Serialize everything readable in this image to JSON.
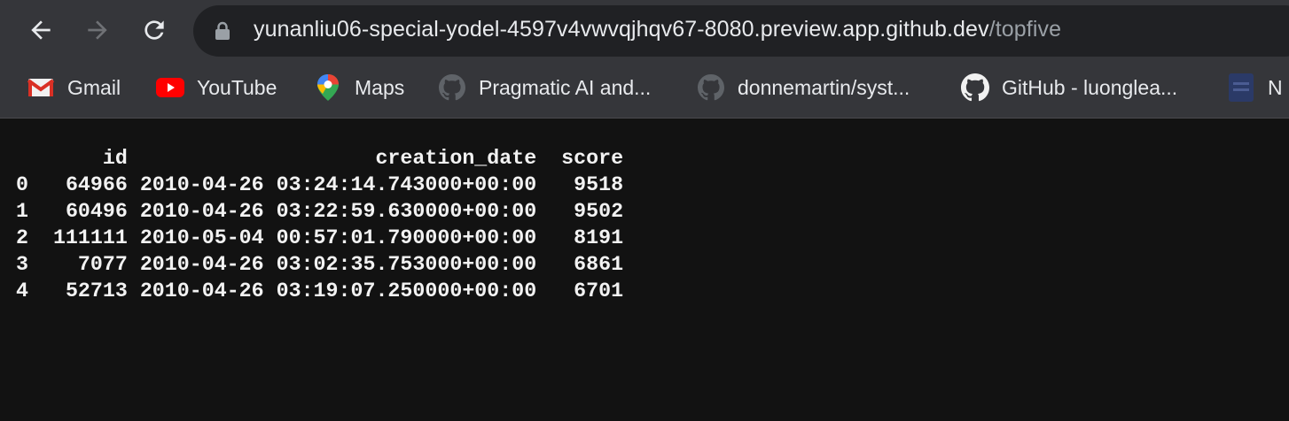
{
  "browser": {
    "url_host": "yunanliu06-special-yodel-4597v4vwvqjhqv67-8080.preview.app.github.dev",
    "url_path": "/topfive",
    "bookmarks": [
      {
        "label": "Gmail",
        "icon": "gmail-icon"
      },
      {
        "label": "YouTube",
        "icon": "youtube-icon"
      },
      {
        "label": "Maps",
        "icon": "maps-icon"
      },
      {
        "label": "Pragmatic AI and...",
        "icon": "github-icon"
      },
      {
        "label": "donnemartin/syst...",
        "icon": "github-icon"
      },
      {
        "label": "GitHub - luonglea...",
        "icon": "github-icon"
      },
      {
        "label": "N",
        "icon": "bookmark-icon"
      }
    ]
  },
  "table": {
    "header": {
      "index": "",
      "id": "id",
      "creation_date": "creation_date",
      "score": "score"
    },
    "rows": [
      {
        "index": "0",
        "id": "64966",
        "creation_date": "2010-04-26 03:24:14.743000+00:00",
        "score": "9518"
      },
      {
        "index": "1",
        "id": "60496",
        "creation_date": "2010-04-26 03:22:59.630000+00:00",
        "score": "9502"
      },
      {
        "index": "2",
        "id": "111111",
        "creation_date": "2010-05-04 00:57:01.790000+00:00",
        "score": "8191"
      },
      {
        "index": "3",
        "id": "7077",
        "creation_date": "2010-04-26 03:02:35.753000+00:00",
        "score": "6861"
      },
      {
        "index": "4",
        "id": "52713",
        "creation_date": "2010-04-26 03:19:07.250000+00:00",
        "score": "6701"
      }
    ]
  }
}
